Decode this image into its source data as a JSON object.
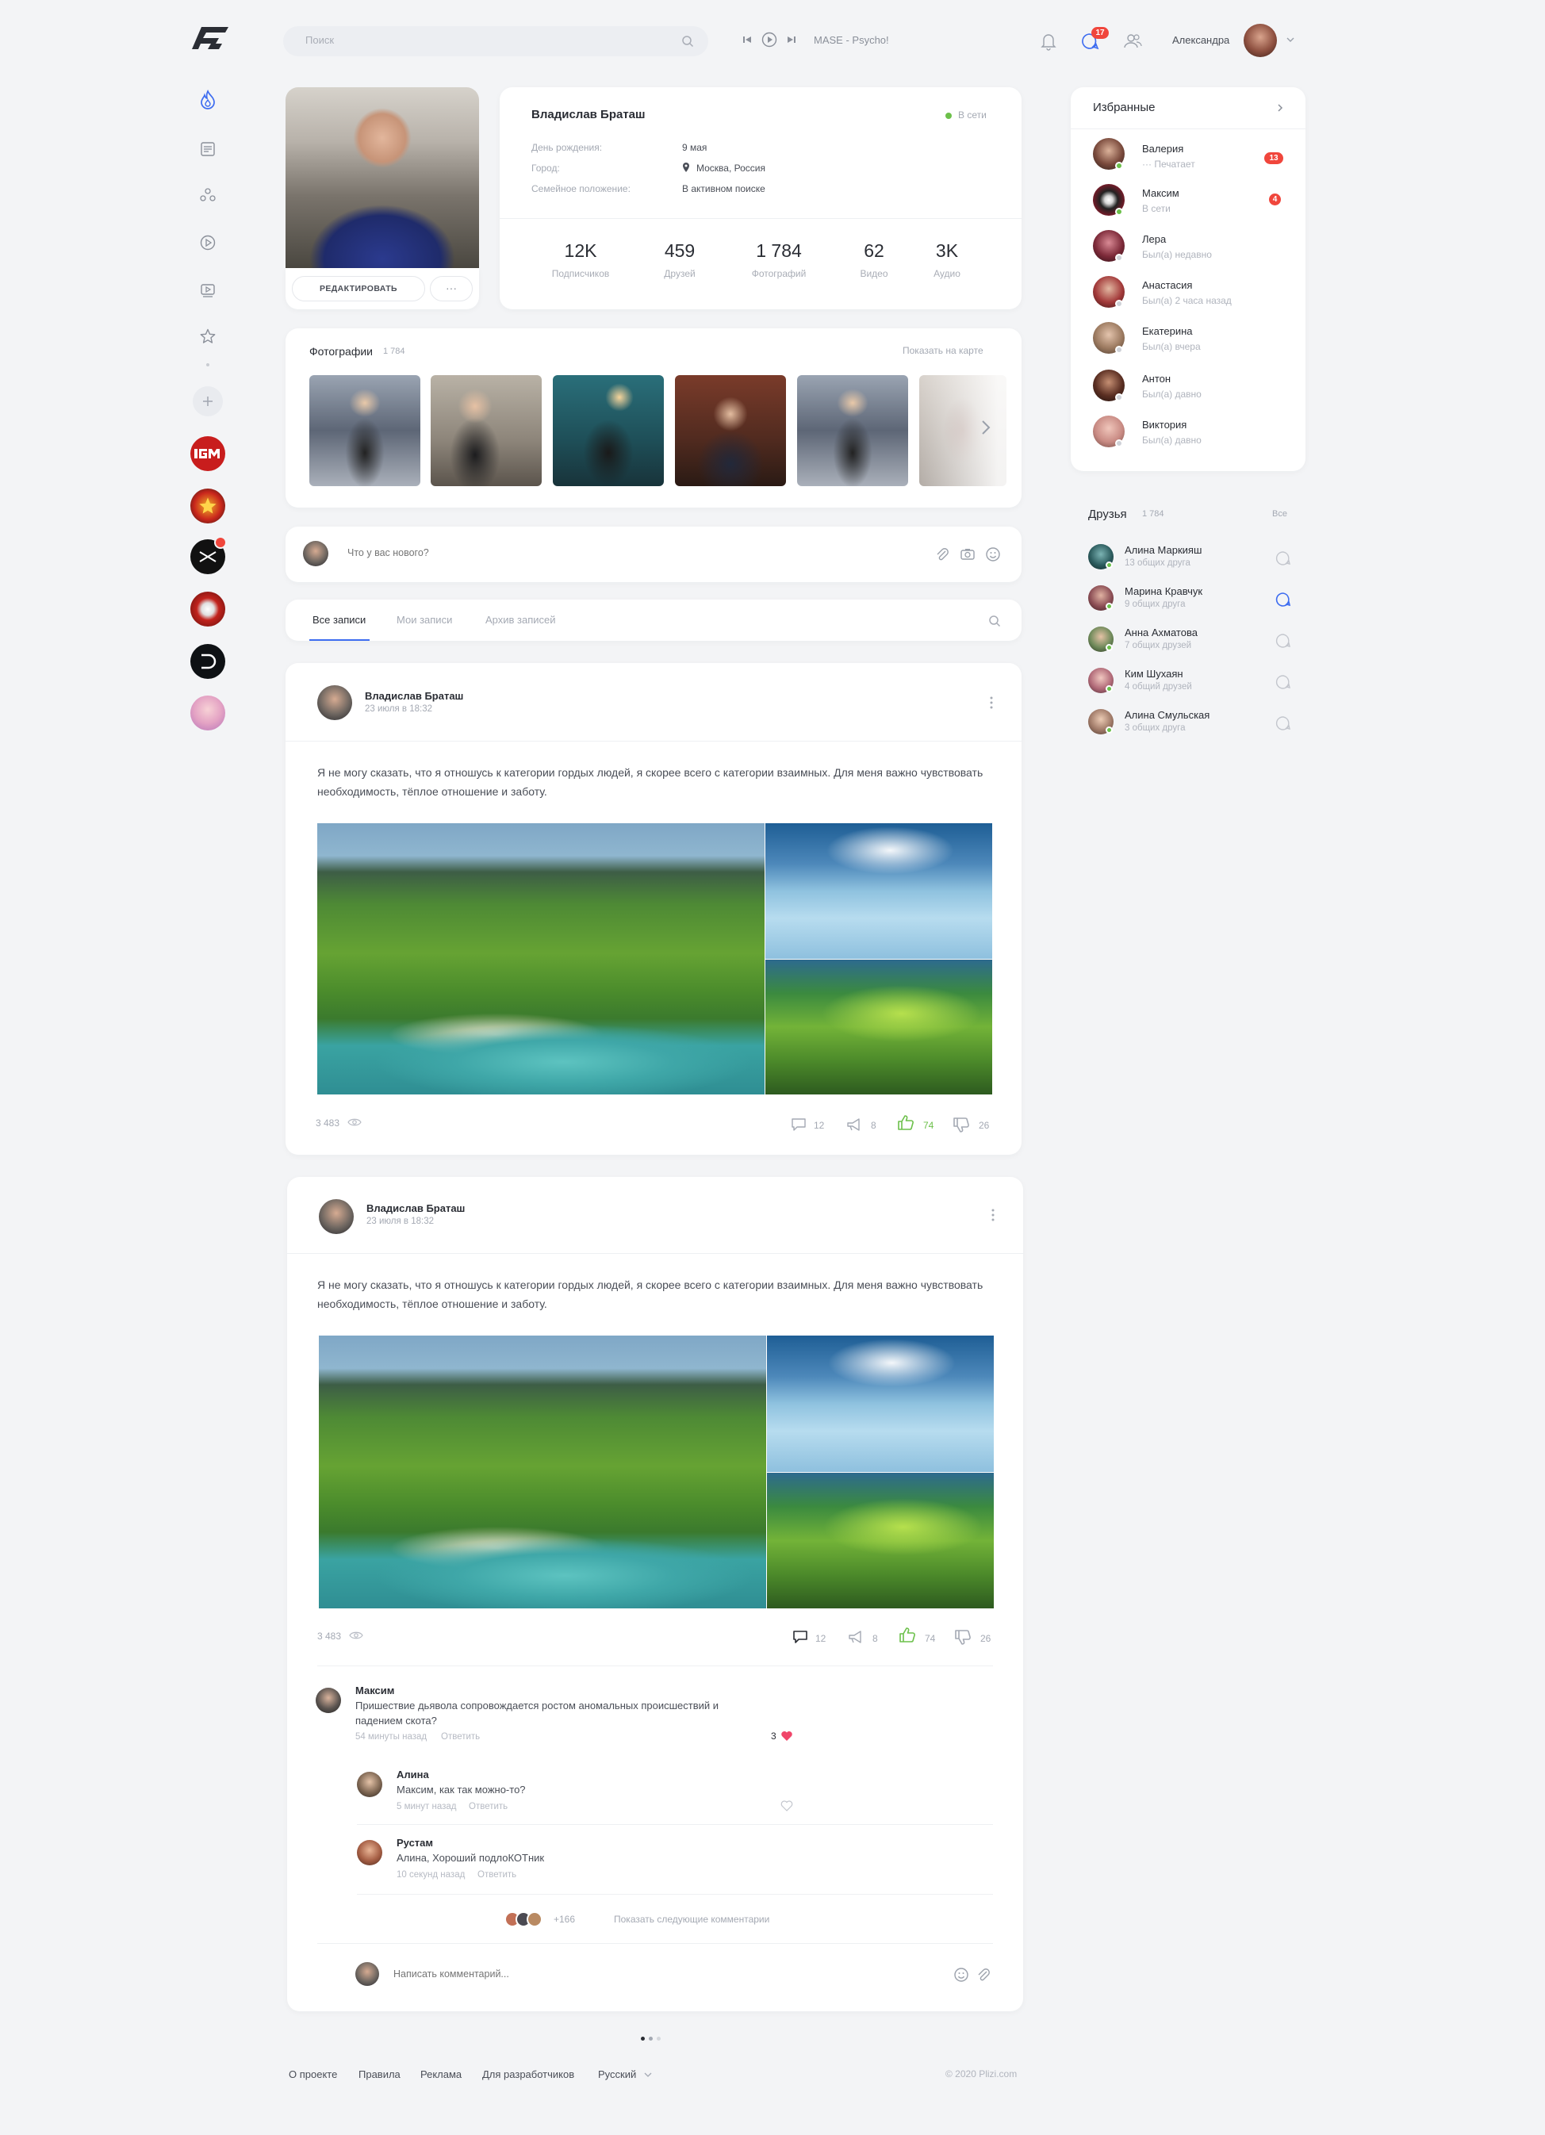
{
  "header": {
    "search_placeholder": "Поиск",
    "track": "MASE - Psycho!",
    "messages_badge": "17",
    "user_name": "Александра"
  },
  "profile": {
    "name": "Владислав Браташ",
    "status": "В сети",
    "edit_label": "РЕДАКТИРОВАТЬ",
    "more_label": "···",
    "info": [
      {
        "label": "День рождения:",
        "value": "9 мая"
      },
      {
        "label": "Город:",
        "value": "Москва, Россия"
      },
      {
        "label": "Семейное положение:",
        "value": "В активном поиске"
      }
    ],
    "stats": [
      {
        "value": "12K",
        "label": "Подписчиков"
      },
      {
        "value": "459",
        "label": "Друзей"
      },
      {
        "value": "1 784",
        "label": "Фотографий"
      },
      {
        "value": "62",
        "label": "Видео"
      },
      {
        "value": "3K",
        "label": "Аудио"
      }
    ]
  },
  "photos": {
    "title": "Фотографии",
    "count": "1 784",
    "map_link": "Показать на карте"
  },
  "composer": {
    "placeholder": "Что у вас нового?"
  },
  "tabs": [
    "Все записи",
    "Мои записи",
    "Архив записей"
  ],
  "posts": [
    {
      "author": "Владислав Браташ",
      "date": "23 июля в 18:32",
      "text": "Я не могу сказать, что я отношусь к категории гордых людей, я скорее всего с категории взаимных. Для меня важно чувствовать необходимость, тёплое отношение и заботу.",
      "views": "3 483",
      "comments": "12",
      "reposts": "8",
      "likes": "74",
      "dislikes": "26"
    },
    {
      "author": "Владислав Браташ",
      "date": "23 июля в 18:32",
      "text": "Я не могу сказать, что я отношусь к категории гордых людей, я скорее всего с категории взаимных. Для меня важно чувствовать необходимость, тёплое отношение и заботу.",
      "views": "3 483",
      "comments": "12",
      "reposts": "8",
      "likes": "74",
      "dislikes": "26"
    }
  ],
  "comments": [
    {
      "name": "Максим",
      "text": "Пришествие дьявола сопровождается ростом аномальных происшествий и падением скота?",
      "time": "54 минуты назад",
      "reply": "Ответить",
      "likes": "3"
    },
    {
      "name": "Алина",
      "text": "Максим, как так можно-то?",
      "time": "5 минут назад",
      "reply": "Ответить"
    },
    {
      "name": "Рустам",
      "text": "Алина, Хороший подлоКОТник",
      "time": "10 секунд назад",
      "reply": "Ответить"
    }
  ],
  "comments_more": {
    "count": "+166",
    "label": "Показать следующие комментарии"
  },
  "comment_input_placeholder": "Написать комментарий...",
  "favorites": {
    "title": "Избранные",
    "items": [
      {
        "name": "Валерия",
        "status": "··· Печатает",
        "badge": "13"
      },
      {
        "name": "Максим",
        "status": "В сети",
        "badge": "4"
      },
      {
        "name": "Лера",
        "status": "Был(а) недавно"
      },
      {
        "name": "Анастасия",
        "status": "Был(а) 2 часа назад"
      },
      {
        "name": "Екатерина",
        "status": "Был(а) вчера"
      },
      {
        "name": "Антон",
        "status": "Был(а) давно"
      },
      {
        "name": "Виктория",
        "status": "Был(а) давно"
      }
    ]
  },
  "friends": {
    "title": "Друзья",
    "count": "1 784",
    "all_label": "Все",
    "items": [
      {
        "name": "Алина Маркияш",
        "sub": "13 общих друга"
      },
      {
        "name": "Марина Кравчук",
        "sub": "9 общих друга"
      },
      {
        "name": "Анна Ахматова",
        "sub": "7 общих друзей"
      },
      {
        "name": "Ким Шухаян",
        "sub": "4 общий друзей"
      },
      {
        "name": "Алина Смульская",
        "sub": "3 общих друга"
      }
    ]
  },
  "footer": {
    "links": [
      "О проекте",
      "Правила",
      "Реклама",
      "Для разработчиков",
      "Русский"
    ],
    "copyright": "© 2020 Plizi.com"
  },
  "colors": {
    "accent": "#3d6cf0",
    "online": "#6cc04a",
    "badge": "#f0463c",
    "like": "#6cc04a"
  }
}
